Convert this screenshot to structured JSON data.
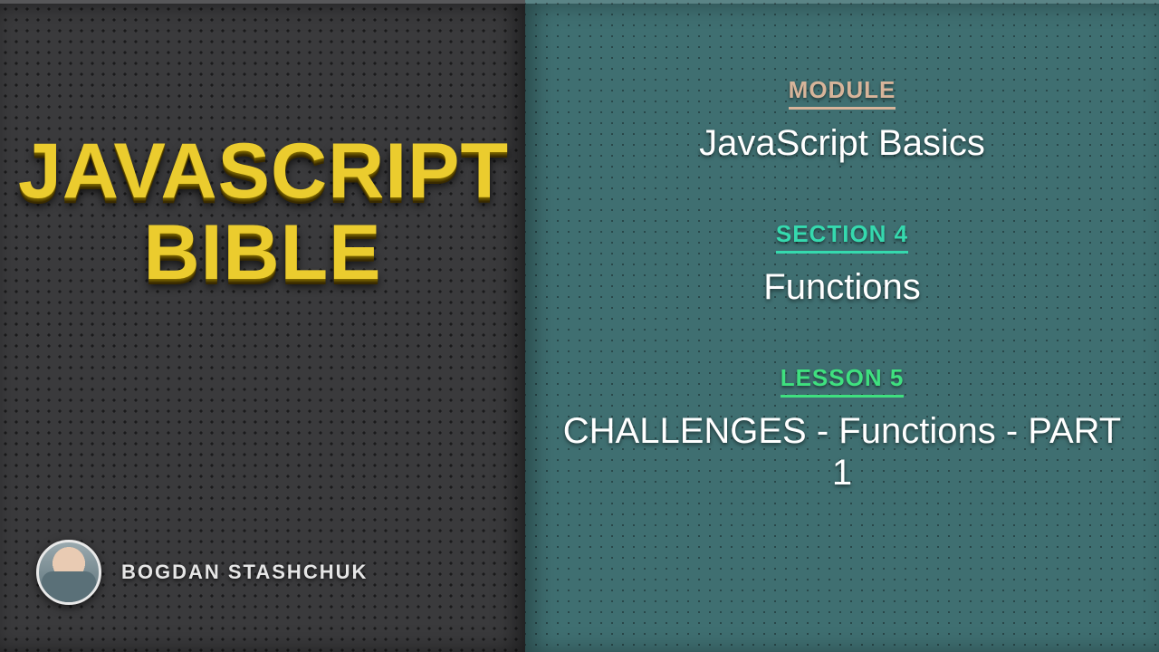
{
  "left": {
    "title_line1": "JAVASCRIPT",
    "title_line2": "BIBLE",
    "author": "BOGDAN STASHCHUK"
  },
  "right": {
    "module": {
      "label": "MODULE",
      "value": "JavaScript Basics"
    },
    "section": {
      "label": "SECTION 4",
      "value": "Functions"
    },
    "lesson": {
      "label": "LESSON 5",
      "value": "CHALLENGES - Functions - PART 1"
    }
  }
}
